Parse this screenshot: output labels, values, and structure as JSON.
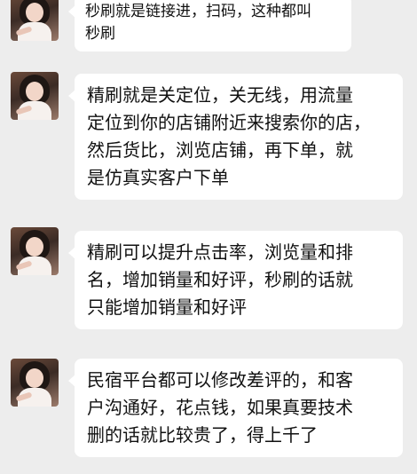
{
  "messages": [
    {
      "lines": [
        "秒刷就是链接进，扫码，这种都叫",
        "秒刷"
      ]
    },
    {
      "lines": [
        "精刷就是关定位，关无线，用流量",
        "定位到你的店铺附近来搜索你的店，",
        "然后货比，浏览店铺，再下单，就",
        "是仿真实客户下单"
      ]
    },
    {
      "lines": [
        "精刷可以提升点击率，浏览量和排",
        "名，增加销量和好评，秒刷的话就",
        "只能增加销量和好评"
      ]
    },
    {
      "lines": [
        "民宿平台都可以修改差评的，和客",
        "户沟通好，花点钱，如果真要技术",
        "删的话就比较贵了，得上千了"
      ]
    }
  ]
}
